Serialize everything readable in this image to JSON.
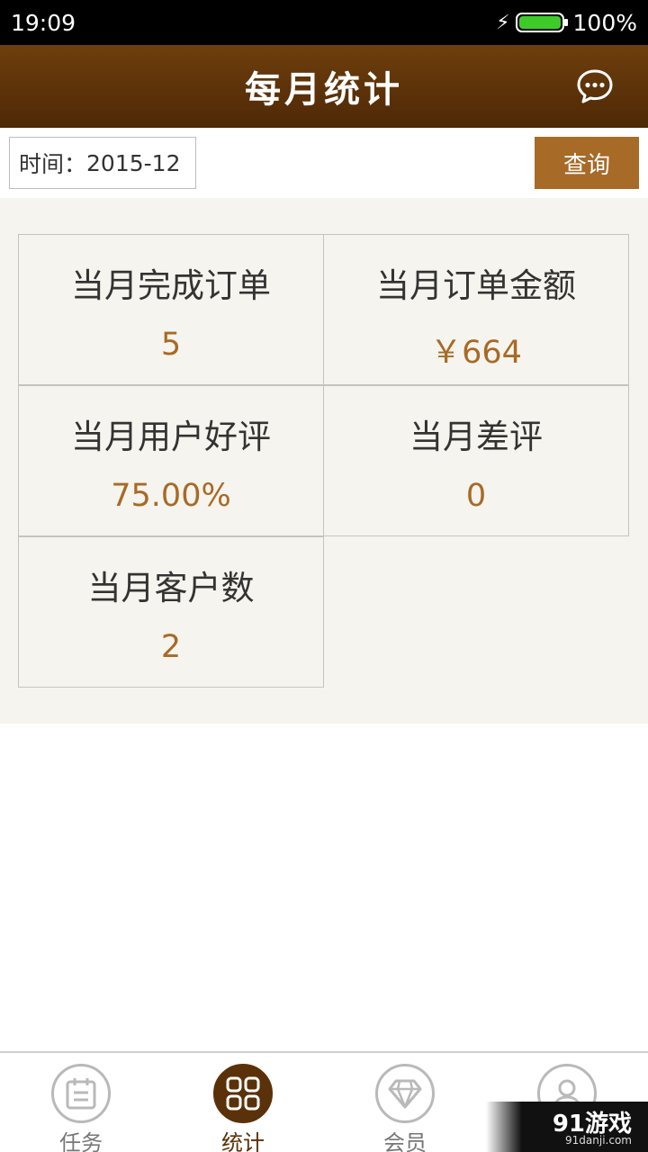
{
  "status_bar": {
    "time": "19:09",
    "battery_level": 100,
    "battery_text": "100%",
    "battery_color": "#3ecb2a"
  },
  "header": {
    "title": "每月统计",
    "icon": "chat-bubble-icon"
  },
  "query": {
    "date_label": "时间：",
    "date_value": "2015-12",
    "button_label": "查询"
  },
  "stats": [
    {
      "label": "当月完成订单",
      "value": "5"
    },
    {
      "label": "当月订单金额",
      "value": "￥664"
    },
    {
      "label": "当月用户好评",
      "value": "75.00%"
    },
    {
      "label": "当月差评",
      "value": "0"
    },
    {
      "label": "当月客户数",
      "value": "2"
    }
  ],
  "nav": [
    {
      "label": "任务",
      "icon": "calendar-icon",
      "active": false
    },
    {
      "label": "统计",
      "icon": "grid-icon",
      "active": true
    },
    {
      "label": "会员",
      "icon": "diamond-icon",
      "active": false
    },
    {
      "label": "",
      "icon": "user-icon",
      "active": false
    }
  ],
  "watermark": {
    "logo": "91游戏",
    "url": "91danji.com"
  },
  "colors": {
    "header": "#5a3108",
    "accent": "#a86a27",
    "panel_bg": "#f6f4ee"
  }
}
